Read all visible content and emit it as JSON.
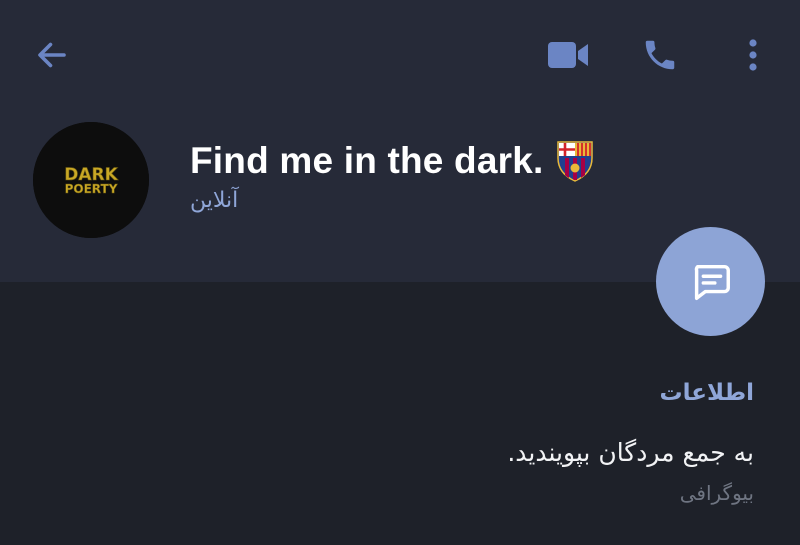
{
  "header": {
    "title": "Find me in the dark.",
    "status": "آنلاین",
    "avatar_text": [
      "DARK",
      "POERTY"
    ],
    "badge_icon": "fc-barcelona-crest-icon"
  },
  "toolbar": {
    "icons": [
      "back-arrow-icon",
      "video-call-icon",
      "phone-icon",
      "more-vertical-icon"
    ]
  },
  "fab": {
    "icon": "message-icon"
  },
  "info": {
    "heading": "اطلاعات",
    "bio": "به جمع مردگان بپوینديد.",
    "bio_label": "بیوگرافی"
  },
  "colors": {
    "background": "#1e2129",
    "header_background": "#262a38",
    "accent": "#8da4d6",
    "icon": "#6b85c4",
    "text_primary": "#ffffff",
    "text_muted": "#6f7582"
  }
}
